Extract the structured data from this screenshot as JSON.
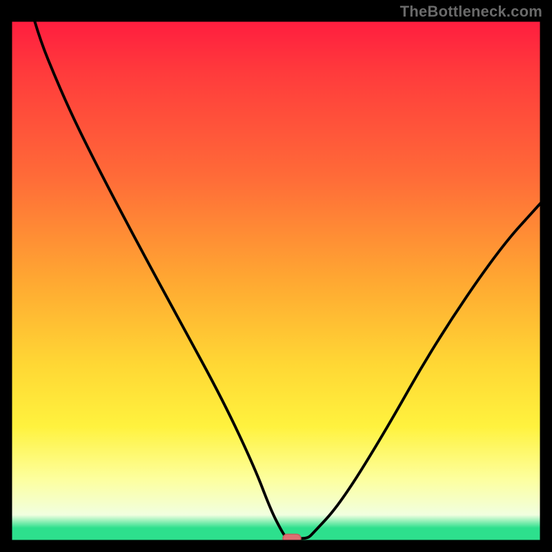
{
  "watermark": "TheBottleneck.com",
  "colors": {
    "black": "#000000",
    "curve": "#000000",
    "marker_fill": "#dd6f72",
    "marker_stroke": "#c85a5d",
    "grad_top": "#ff1d3f",
    "grad_1": "#ff3b3c",
    "grad_2": "#ff6b38",
    "grad_3": "#ffa832",
    "grad_4": "#ffd734",
    "grad_5": "#fff23e",
    "grad_pale": "#fdff9d",
    "grad_near_white": "#f1ffe0",
    "grad_green": "#2de08d"
  },
  "chart_data": {
    "type": "line",
    "title": "",
    "xlabel": "",
    "ylabel": "",
    "xlim": [
      0,
      100
    ],
    "ylim": [
      0,
      100
    ],
    "x": [
      0,
      4,
      10,
      16,
      24,
      32,
      40,
      46,
      49,
      51,
      52,
      54,
      56,
      57,
      62,
      70,
      80,
      92,
      100
    ],
    "values": [
      120,
      100,
      85,
      72.5,
      57,
      42,
      27,
      14,
      6,
      2,
      0.5,
      0.5,
      0.5,
      1.5,
      7,
      20,
      38,
      56,
      65
    ],
    "marker": {
      "x": 53,
      "y": 0.5
    },
    "notes": "V-shaped bottleneck curve over vertical rainbow heat gradient; black plot border inset ~16px; green band occupies bottom ~2.5% of plot height."
  }
}
